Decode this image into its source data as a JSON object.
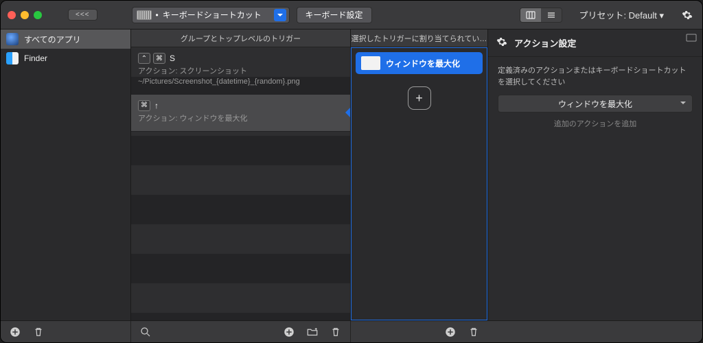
{
  "toolbar": {
    "back": "<<<",
    "dropdown_bullet": "•",
    "dropdown_label": "キーボードショートカット",
    "keyboard_settings": "キーボード設定",
    "preset_label": "プリセット: Default ▾"
  },
  "sidebar": {
    "items": [
      {
        "label": "すべてのアプリ"
      },
      {
        "label": "Finder"
      }
    ]
  },
  "triggers": {
    "header": "グループとトップレベルのトリガー",
    "rows": [
      {
        "key_caps": [
          "⌃",
          "⌘"
        ],
        "key_letter": "S",
        "subtitle": "アクション: スクリーンショット ~/Pictures/Screenshot_{datetime}_{random}.png"
      },
      {
        "key_caps": [
          "⌘"
        ],
        "key_letter": "↑",
        "subtitle": "アクション: ウィンドウを最大化"
      }
    ],
    "add": "+"
  },
  "actions_col": {
    "header": "選択したトリガーに割り当てられてい…",
    "chip": "ウィンドウを最大化",
    "add": "+"
  },
  "panel": {
    "title": "アクション設定",
    "hint": "定義済みのアクションまたはキーボードショートカットを選択してください",
    "select_value": "ウィンドウを最大化",
    "add_action": "追加のアクションを追加"
  }
}
